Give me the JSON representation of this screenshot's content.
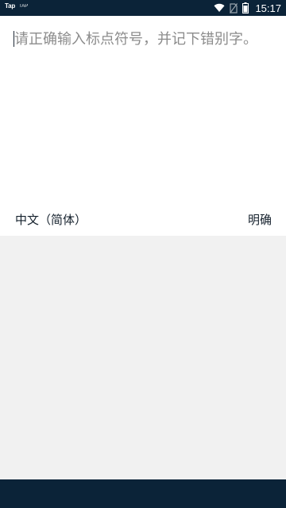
{
  "status_bar": {
    "app_tag": "Tap",
    "app_tag_small": "ΤΑΡ",
    "time": "15:17",
    "icons": [
      "wifi-icon",
      "no-sim-icon",
      "battery-icon"
    ]
  },
  "editor": {
    "placeholder": "请正确输入标点符号，并记下错别字。"
  },
  "language_row": {
    "language": "中文（简体）",
    "confirm_label": "明确"
  },
  "colors": {
    "status_bar": "#0b2338",
    "nav_bar": "#0b2338",
    "panel": "#f1f1f1",
    "placeholder_text": "#8c8c8c",
    "label_text": "#14202c"
  }
}
